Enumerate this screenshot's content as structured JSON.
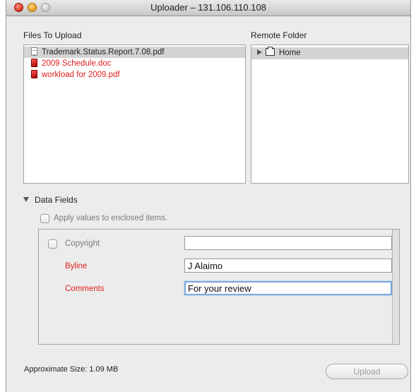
{
  "window": {
    "title": "Uploader – 131.106.110.108"
  },
  "files_to_upload": {
    "label": "Files To Upload",
    "items": [
      {
        "name": "Trademark.Status.Report.7.08.pdf",
        "status": "ok",
        "icon": "document-icon"
      },
      {
        "name": "2009 Schedule.doc",
        "status": "error",
        "icon": "error-file-icon"
      },
      {
        "name": "workload for 2009.pdf",
        "status": "error",
        "icon": "error-file-icon"
      }
    ]
  },
  "remote_folder": {
    "label": "Remote Folder",
    "items": [
      {
        "name": "Home",
        "icon": "folder-icon"
      }
    ]
  },
  "data_fields": {
    "label": "Data Fields",
    "apply_label": "Apply values to enclosed items.",
    "fields": [
      {
        "label": "Copyright",
        "value": "",
        "has_checkbox": true,
        "color": "grey"
      },
      {
        "label": "Byline",
        "value": "J Alaimo",
        "color": "red"
      },
      {
        "label": "Comments",
        "value": "For your review",
        "color": "red",
        "focused": true
      }
    ]
  },
  "footer": {
    "size_label": "Approximate Size: 1.09 MB",
    "upload_label": "Upload"
  },
  "colors": {
    "error": "#e01e1e",
    "selection": "#d4d4d4",
    "focus": "#7aa7e0"
  }
}
